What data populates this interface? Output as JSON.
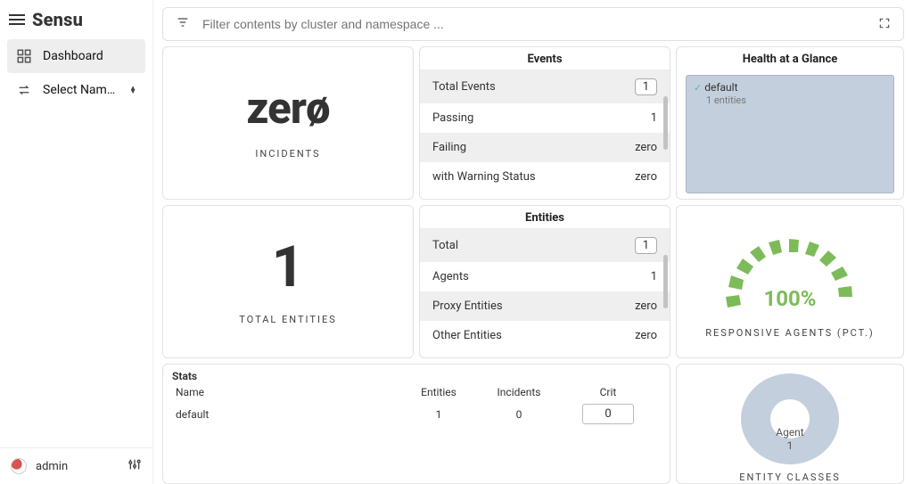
{
  "brand": "Sensu",
  "sidebar": {
    "dashboard": "Dashboard",
    "namespace": "Select Name…",
    "user": "admin"
  },
  "filter": {
    "placeholder": "Filter contents by cluster and namespace ..."
  },
  "incidents": {
    "value": "zerø",
    "label": "INCIDENTS"
  },
  "total_entities": {
    "value": "1",
    "label": "TOTAL ENTITIES"
  },
  "events": {
    "title": "Events",
    "rows": [
      {
        "label": "Total Events",
        "value": "1",
        "badge": true
      },
      {
        "label": "Passing",
        "value": "1"
      },
      {
        "label": "Failing",
        "value": "zero"
      },
      {
        "label": "with Warning Status",
        "value": "zero"
      }
    ]
  },
  "entities": {
    "title": "Entities",
    "rows": [
      {
        "label": "Total",
        "value": "1",
        "badge": true
      },
      {
        "label": "Agents",
        "value": "1"
      },
      {
        "label": "Proxy Entities",
        "value": "zero"
      },
      {
        "label": "Other Entities",
        "value": "zero"
      }
    ]
  },
  "health": {
    "title": "Health at a Glance",
    "item_name": "default",
    "item_sub": "1 entities"
  },
  "gauge": {
    "pct": "100%",
    "label": "RESPONSIVE AGENTS (PCT.)"
  },
  "stats": {
    "title": "Stats",
    "headers": {
      "name": "Name",
      "entities": "Entities",
      "incidents": "Incidents",
      "crit": "Crit"
    },
    "row": {
      "name": "default",
      "entities": "1",
      "incidents": "0",
      "crit": "0"
    }
  },
  "donut": {
    "label1": "Agent",
    "label2": "1",
    "caption": "ENTITY CLASSES"
  }
}
